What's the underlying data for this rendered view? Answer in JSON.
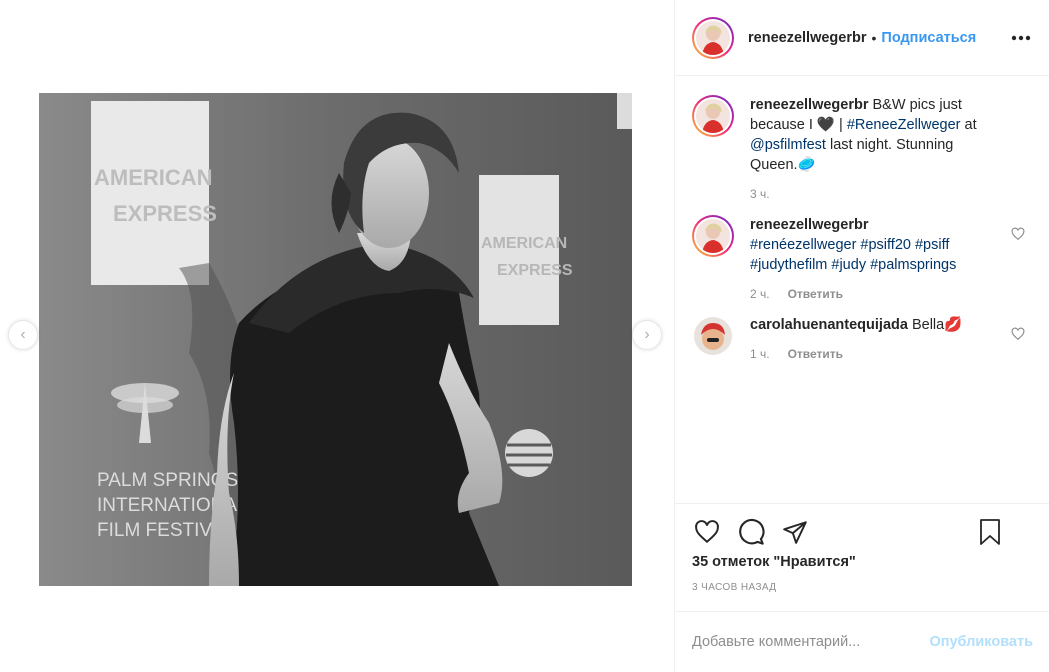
{
  "post": {
    "username": "reneezellwegerbr",
    "dot": "•",
    "follow_label": "Подписаться",
    "more_label": "•••"
  },
  "photo": {
    "type": "black-and-white photo",
    "backdrop_sign_1": "AMERICAN EXPRESS",
    "backdrop_sign_2": "AMERICAN EXPRESS",
    "festival_logo": "PALM SPRINGS INTERNATIONAL FILM FESTIVAL"
  },
  "caption": {
    "username": "reneezellwegerbr",
    "text_1": "B&W pics just because I",
    "heart_emoji": "🖤",
    "text_2": "|",
    "hashtag": "#ReneeZellweger",
    "text_3": "at",
    "mention": "@psfilmfest",
    "text_4": "last night. Stunning Queen.",
    "emoji": "🥏",
    "time": "3 ч."
  },
  "comments": [
    {
      "username": "reneezellwegerbr",
      "hashtags": "#renéezellweger #psiff20 #psiff #judythefilm #judy #palmsprings",
      "time": "2 ч.",
      "reply": "Ответить"
    },
    {
      "username": "carolahuenantequijada",
      "text": "Bella",
      "emoji": "💋",
      "time": "1 ч.",
      "reply": "Ответить"
    }
  ],
  "actions": {
    "likes": "35 отметок \"Нравится\"",
    "timestamp": "3 часов назад"
  },
  "add_comment": {
    "placeholder": "Добавьте комментарий...",
    "post_label": "Опубликовать"
  },
  "colors": {
    "link": "#003569",
    "follow": "#3897f0",
    "post_disabled": "#b2dffc",
    "muted": "#8e8e8e"
  }
}
